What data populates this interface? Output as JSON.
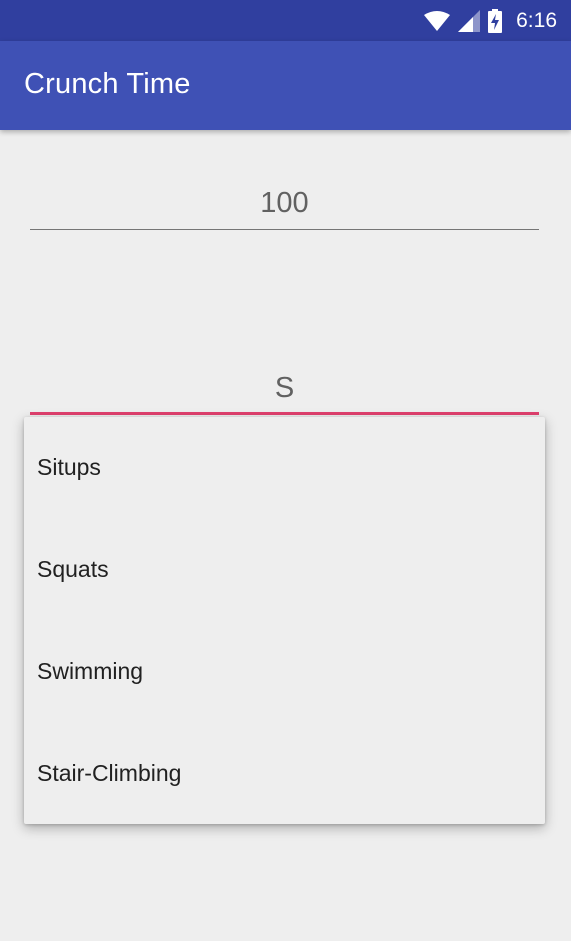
{
  "status_bar": {
    "time": "6:16",
    "icons": [
      "wifi-icon",
      "cell-signal-icon",
      "battery-charging-icon"
    ]
  },
  "app_bar": {
    "title": "Crunch Time"
  },
  "count_field": {
    "value": "100"
  },
  "exercise_field": {
    "value": "S"
  },
  "suggestions": [
    "Situps",
    "Squats",
    "Swimming",
    "Stair-Climbing"
  ],
  "colors": {
    "status_bar": "#303f9f",
    "primary": "#3f51b5",
    "accent": "#e0406e",
    "background": "#eeeeee"
  }
}
